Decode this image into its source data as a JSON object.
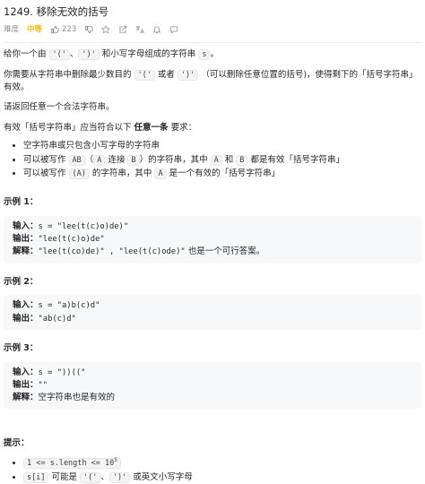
{
  "header": {
    "title": "1249. 移除无效的括号",
    "difficulty_label": "难度",
    "difficulty_value": "中等",
    "likes": "223"
  },
  "body": {
    "p1_a": "给你一个由 ",
    "p1_code1": "'('",
    "p1_b": "、",
    "p1_code2": "')'",
    "p1_c": " 和小写字母组成的字符串 ",
    "p1_code3": "s",
    "p1_d": "。",
    "p2_a": "你需要从字符串中删除最少数目的 ",
    "p2_code1": "'('",
    "p2_b": " 或者 ",
    "p2_code2": "')'",
    "p2_c": " （可以删除任意位置的括号)，使得剩下的「括号字符串」有效。",
    "p3": "请返回任意一个合法字符串。",
    "p4_a": "有效「括号字符串」应当符合以下 ",
    "p4_bold": "任意一条",
    "p4_b": " 要求：",
    "li1": "空字符串或只包含小写字母的字符串",
    "li2_a": "可以被写作 ",
    "li2_code1": "AB",
    "li2_b": "（",
    "li2_code2": "A",
    "li2_c": " 连接 ",
    "li2_code3": "B",
    "li2_d": "）的字符串，其中 ",
    "li2_code4": "A",
    "li2_e": " 和 ",
    "li2_code5": "B",
    "li2_f": " 都是有效「括号字符串」",
    "li3_a": "可以被写作 ",
    "li3_code1": "(A)",
    "li3_b": " 的字符串，其中 ",
    "li3_code2": "A",
    "li3_c": " 是一个有效的「括号字符串」"
  },
  "examples": [
    {
      "title": "示例 1：",
      "input_label": "输入：",
      "input": "s = \"lee(t(c)o)de)\"",
      "output_label": "输出：",
      "output": "\"lee(t(c)o)de\"",
      "explain_label": "解释：",
      "explain_mono": "\"lee(t(co)de)\" , \"lee(t(c)ode)\"",
      "explain_text": " 也是一个可行答案。"
    },
    {
      "title": "示例 2：",
      "input_label": "输入：",
      "input": "s = \"a)b(c)d\"",
      "output_label": "输出：",
      "output": "\"ab(c)d\""
    },
    {
      "title": "示例 3：",
      "input_label": "输入：",
      "input": "s = \"))((\"",
      "output_label": "输出：",
      "output": "\"\"",
      "explain_label": "解释：",
      "explain_text": "空字符串也是有效的"
    }
  ],
  "tips": {
    "title": "提示：",
    "t1_code": "1 <= s.length <= 10",
    "t1_sup": "5",
    "t2_code": "s[i]",
    "t2_a": " 可能是 ",
    "t2_code2": "'('",
    "t2_b": "、",
    "t2_code3": "')'",
    "t2_c": " 或英文小写字母"
  }
}
